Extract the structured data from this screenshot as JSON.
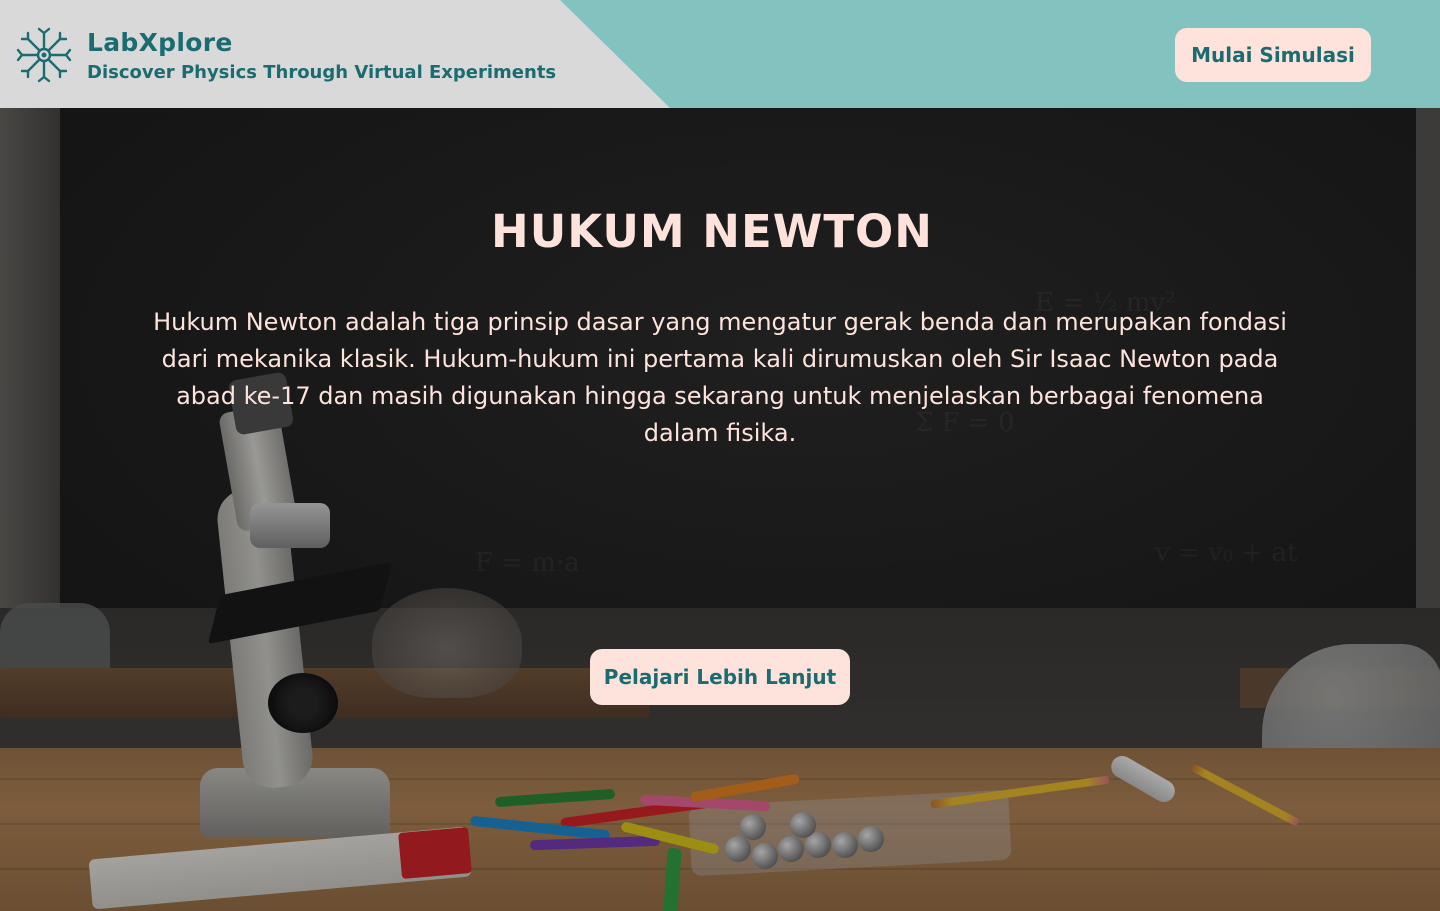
{
  "header": {
    "brand_name": "LabXplore",
    "tagline": "Discover Physics Through Virtual Experiments",
    "logo_icon": "atom-circuit-icon",
    "start_button_label": "Mulai Simulasi"
  },
  "hero": {
    "title": "HUKUM NEWTON",
    "description": "Hukum Newton adalah tiga prinsip dasar yang mengatur gerak benda dan merupakan fondasi dari mekanika klasik. Hukum-hukum ini pertama kali dirumuskan oleh Sir Isaac Newton pada abad ke-17 dan masih digunakan hingga sekarang untuk menjelaskan berbagai fenomena dalam fisika.",
    "learn_more_label": "Pelajari Lebih Lanjut"
  },
  "colors": {
    "header_teal": "#83c3bf",
    "header_gray": "#d9d9d9",
    "brand_text": "#1b6c71",
    "button_bg": "#fde3dc",
    "hero_text": "#fde3dc"
  }
}
